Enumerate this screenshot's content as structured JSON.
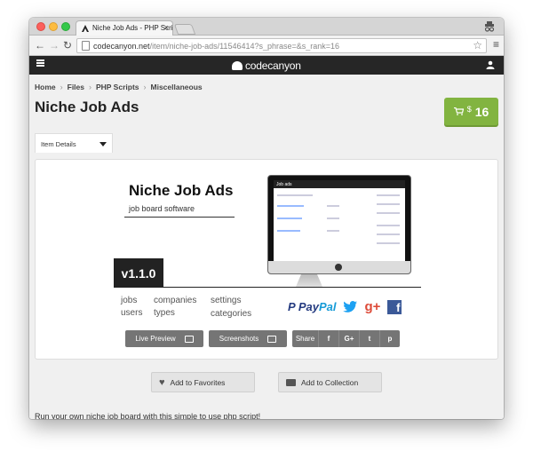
{
  "browser": {
    "tab_title": "Niche Job Ads - PHP Scrip",
    "tab_close": "×",
    "url_host": "codecanyon.net",
    "url_path": "/item/niche-job-ads/11546414?s_phrase=&s_rank=16"
  },
  "site": {
    "logo_text": "codecanyon"
  },
  "breadcrumb": [
    "Home",
    "Files",
    "PHP Scripts",
    "Miscellaneous"
  ],
  "page": {
    "title": "Niche Job Ads",
    "price_currency": "$",
    "price_value": "16",
    "details_tab": "Item Details",
    "description": "Run your own niche job board with this simple to use php script!"
  },
  "preview": {
    "title": "Niche Job Ads",
    "subtitle": "job board software",
    "version": "v1.1.0",
    "features": [
      "jobs",
      "users",
      "companies",
      "types",
      "settings",
      "categories"
    ],
    "paypal_pay": "Pay",
    "paypal_pal": "Pal",
    "gplus": "g+",
    "fb": "f",
    "screen_brand": "Job ads"
  },
  "buttons": {
    "live_preview": "Live Preview",
    "screenshots": "Screenshots",
    "share": "Share",
    "share_facebook": "f",
    "share_gplus": "G+",
    "share_twitter": "t",
    "share_pinterest": "p",
    "add_favorites": "Add to Favorites",
    "add_collection": "Add to Collection"
  },
  "colors": {
    "price_green": "#82b440",
    "header_dark": "#262626",
    "button_gray": "#757575"
  }
}
